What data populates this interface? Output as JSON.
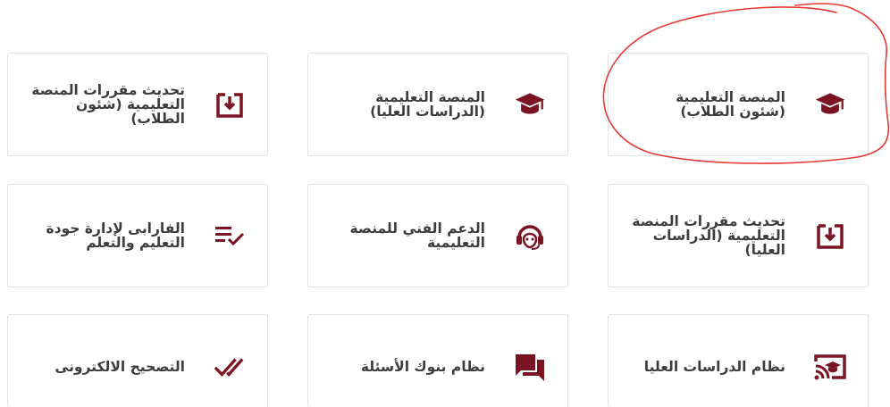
{
  "colors": {
    "accent": "#7a1322",
    "text": "#3c3c3c",
    "border": "#e2e2e2",
    "annotation": "#e53935"
  },
  "cards": [
    {
      "label": "تحديث مقررات المنصة\nالتعليمية (شئون\nالطلاب)",
      "icon": "download-box-icon"
    },
    {
      "label": "المنصة التعليمية\n(الدراسات العليا)",
      "icon": "graduation-cap-icon"
    },
    {
      "label": "المنصة التعليمية\n(شئون الطلاب)",
      "icon": "graduation-cap-icon"
    },
    {
      "label": "الفارابى لإدارة جودة\nالتعليم والتعلم",
      "icon": "list-check-icon"
    },
    {
      "label": "الدعم الفني للمنصة\nالتعليمية",
      "icon": "headset-icon"
    },
    {
      "label": "تحديث مقررات المنصة\nالتعليمية (الدراسات\nالعليا)",
      "icon": "download-box-icon"
    },
    {
      "label": "التصحيح الالكترونى",
      "icon": "double-check-icon"
    },
    {
      "label": "نظام بنوك الأسئلة",
      "icon": "chat-bubbles-icon"
    },
    {
      "label": "نظام الدراسات العليا",
      "icon": "cast-education-icon"
    }
  ]
}
